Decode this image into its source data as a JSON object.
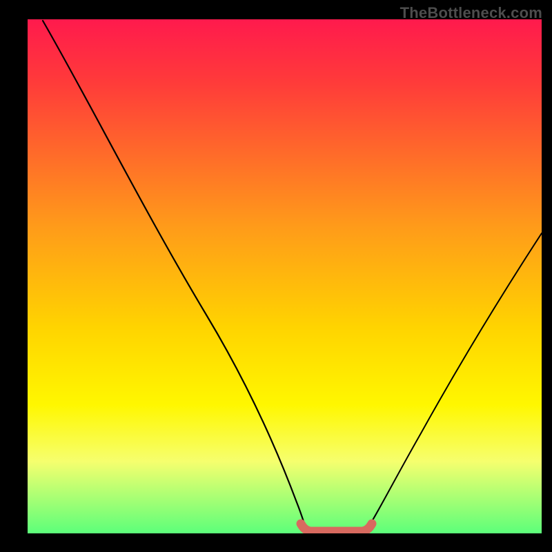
{
  "watermark": "TheBottleneck.com",
  "chart_data": {
    "type": "line",
    "title": "",
    "xlabel": "",
    "ylabel": "",
    "xlim": [
      0,
      100
    ],
    "ylim": [
      0,
      100
    ],
    "grid": false,
    "legend": false,
    "series": [
      {
        "name": "left-branch",
        "x": [
          3,
          10,
          20,
          30,
          40,
          48,
          52
        ],
        "y": [
          99,
          85,
          65,
          45,
          24,
          6,
          1
        ]
      },
      {
        "name": "right-branch",
        "x": [
          66,
          72,
          80,
          90,
          100
        ],
        "y": [
          1,
          9,
          22,
          40,
          58
        ]
      },
      {
        "name": "flat-bottom",
        "x": [
          52,
          55,
          59,
          63,
          66
        ],
        "y": [
          1,
          0.5,
          0.5,
          0.5,
          1
        ]
      }
    ],
    "highlight": {
      "name": "bottom-marker",
      "x": [
        52,
        55,
        57,
        59,
        61,
        63,
        65,
        66
      ],
      "y": [
        2,
        1,
        1,
        1,
        1,
        1,
        1,
        2
      ],
      "color": "#d86a5f"
    },
    "background_gradient": {
      "top": "#ff1a4d",
      "mid": "#ffd400",
      "bottom": "#5cff7a"
    }
  }
}
